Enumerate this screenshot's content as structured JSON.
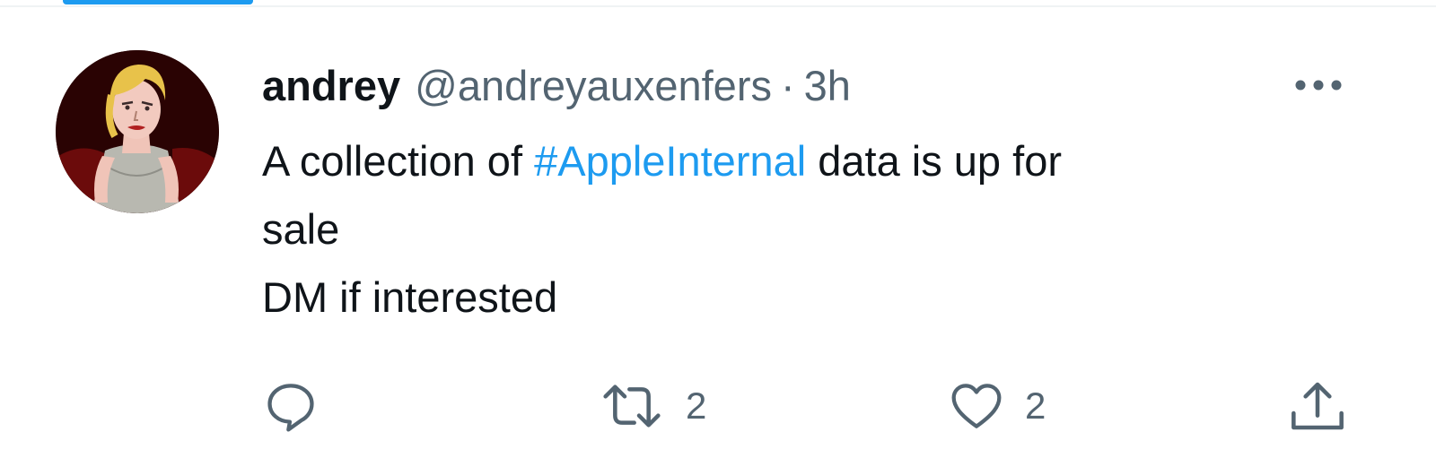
{
  "tweet": {
    "author": {
      "display_name": "andrey",
      "handle": "@andreyauxenfers",
      "avatar": "avatar-illustration"
    },
    "separator": "·",
    "timestamp": "3h",
    "body": {
      "line1_before": "A collection of ",
      "hashtag": "#AppleInternal",
      "line1_after": " data is up for",
      "line2": "sale",
      "line3": "DM if interested"
    },
    "actions": {
      "reply": {
        "icon": "reply-icon",
        "count": ""
      },
      "retweet": {
        "icon": "retweet-icon",
        "count": "2"
      },
      "like": {
        "icon": "heart-icon",
        "count": "2"
      },
      "share": {
        "icon": "share-icon"
      }
    },
    "more_icon": "more-options-icon"
  },
  "colors": {
    "text": "#0f1419",
    "secondary": "#536471",
    "accent": "#1d9bf0",
    "divider": "#eff3f4"
  }
}
